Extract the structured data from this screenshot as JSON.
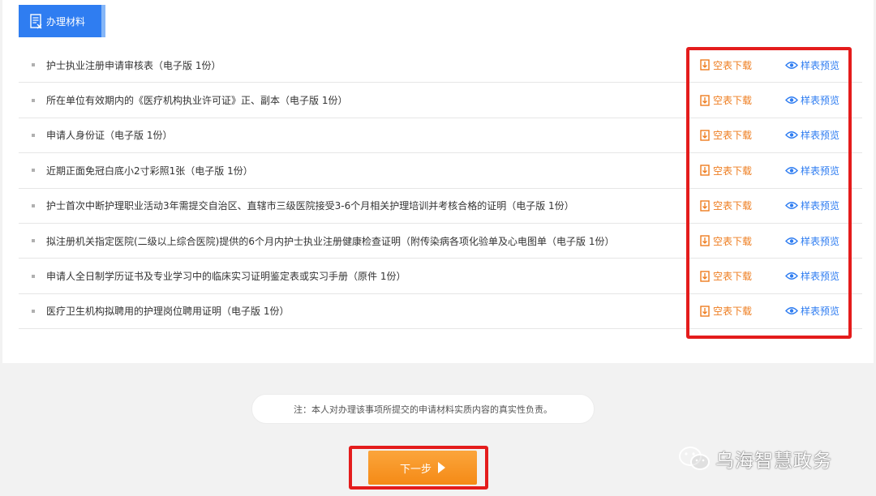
{
  "tab": {
    "label": "办理材料"
  },
  "materials": [
    {
      "name": "护士执业注册申请审核表（电子版 1份）"
    },
    {
      "name": "所在单位有效期内的《医疗机构执业许可证》正、副本（电子版 1份）"
    },
    {
      "name": "申请人身份证（电子版 1份）"
    },
    {
      "name": "近期正面免冠白底小2寸彩照1张（电子版 1份）"
    },
    {
      "name": "护士首次中断护理职业活动3年需提交自治区、直辖市三级医院接受3-6个月相关护理培训并考核合格的证明（电子版 1份）"
    },
    {
      "name": "拟注册机关指定医院(二级以上综合医院)提供的6个月内护士执业注册健康检查证明（附传染病各项化验单及心电图单（电子版 1份）"
    },
    {
      "name": "申请人全日制学历证书及专业学习中的临床实习证明鉴定表或实习手册（原件 1份）"
    },
    {
      "name": "医疗卫生机构拟聘用的护理岗位聘用证明（电子版 1份）"
    }
  ],
  "actions": {
    "download": "空表下载",
    "preview": "样表预览"
  },
  "note": "注：本人对办理该事项所提交的申请材料实质内容的真实性负责。",
  "next_button": "下一步",
  "watermark": "乌海智慧政务",
  "colors": {
    "accent": "#2f7df1",
    "orange": "#ee7c1e",
    "highlight": "#e41c1c"
  }
}
